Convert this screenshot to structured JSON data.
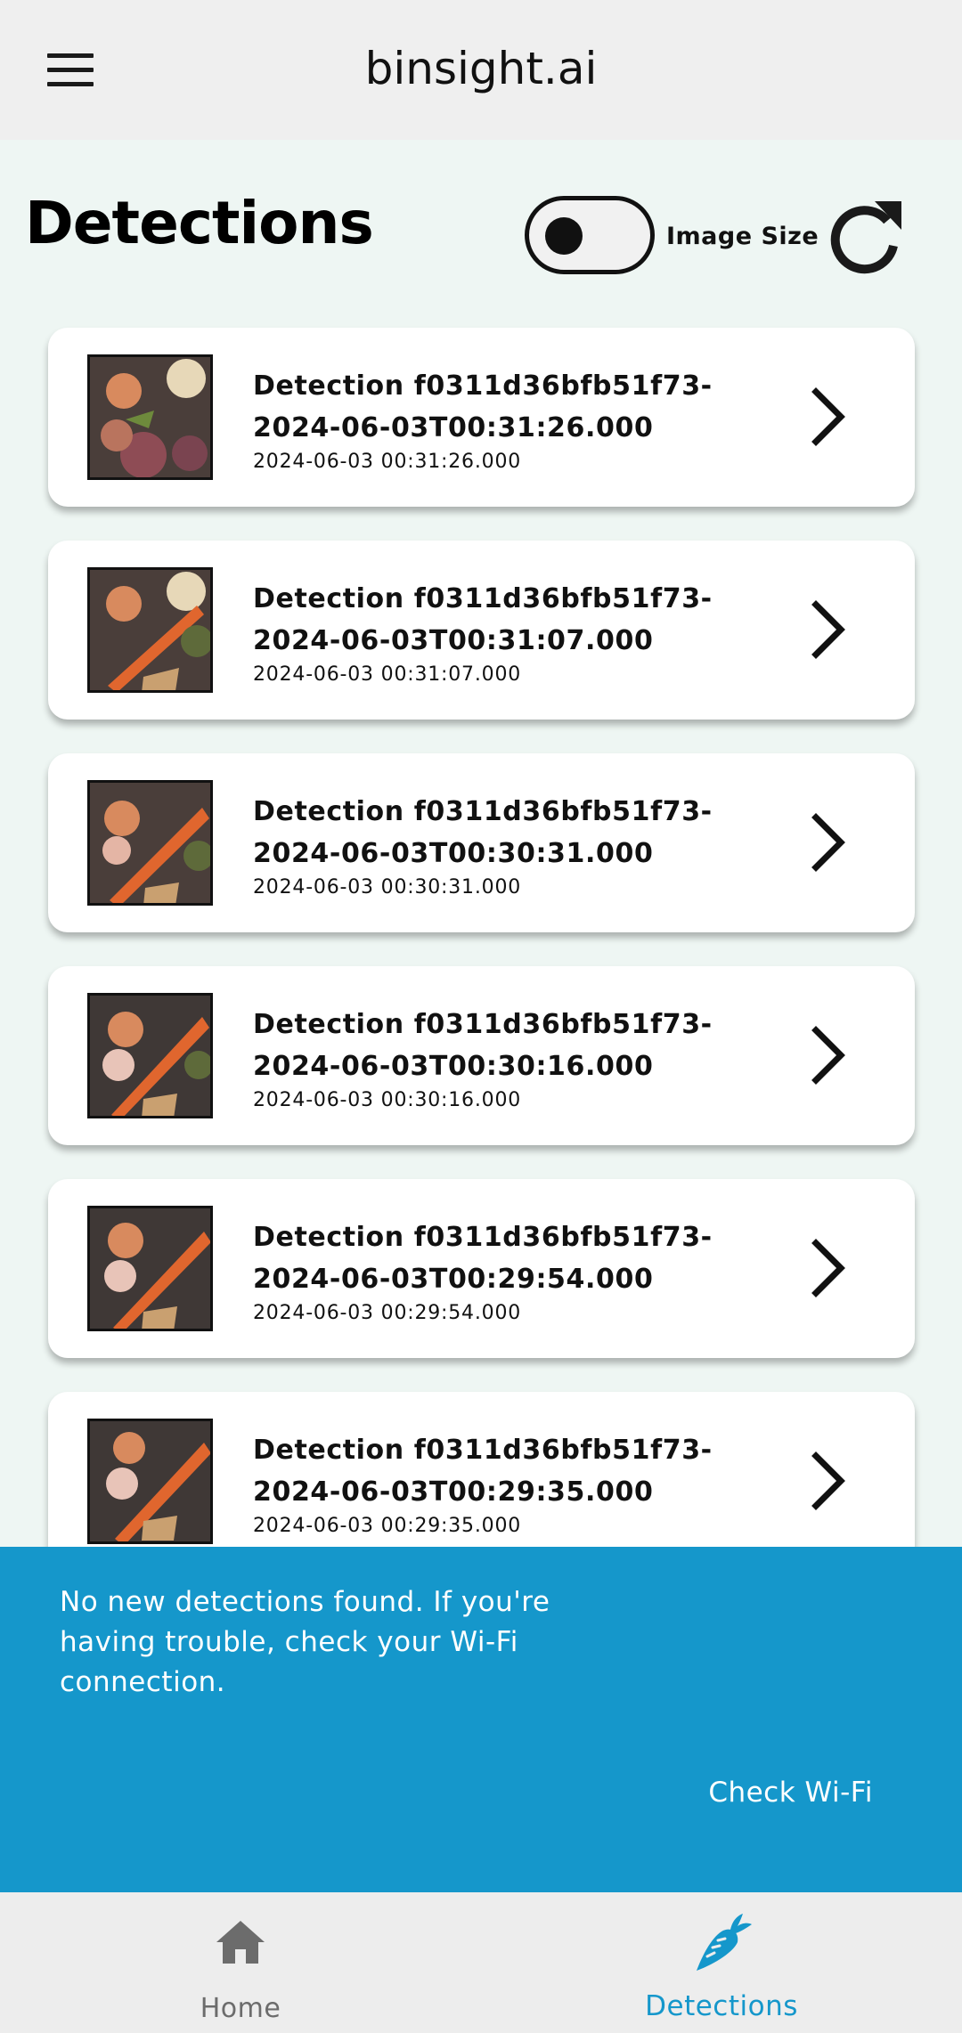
{
  "app": {
    "title": "binsight.ai"
  },
  "page": {
    "title": "Detections",
    "toggle_label": "Image Size"
  },
  "detections": [
    {
      "title": "Detection f0311d36bfb51f73-2024-06-03T00:31:26.000",
      "timestamp": "2024-06-03 00:31:26.000"
    },
    {
      "title": "Detection f0311d36bfb51f73-2024-06-03T00:31:07.000",
      "timestamp": "2024-06-03 00:31:07.000"
    },
    {
      "title": "Detection f0311d36bfb51f73-2024-06-03T00:30:31.000",
      "timestamp": "2024-06-03 00:30:31.000"
    },
    {
      "title": "Detection f0311d36bfb51f73-2024-06-03T00:30:16.000",
      "timestamp": "2024-06-03 00:30:16.000"
    },
    {
      "title": "Detection f0311d36bfb51f73-2024-06-03T00:29:54.000",
      "timestamp": "2024-06-03 00:29:54.000"
    },
    {
      "title": "Detection f0311d36bfb51f73-2024-06-03T00:29:35.000",
      "timestamp": "2024-06-03 00:29:35.000"
    }
  ],
  "snackbar": {
    "message": "No new detections found. If you're having trouble, check your Wi-Fi connection.",
    "action": "Check Wi-Fi"
  },
  "bottom_nav": {
    "home_label": "Home",
    "detections_label": "Detections"
  },
  "colors": {
    "accent": "#1597CB",
    "background": "#EEF6F3",
    "appbar": "#EFEFEF"
  }
}
